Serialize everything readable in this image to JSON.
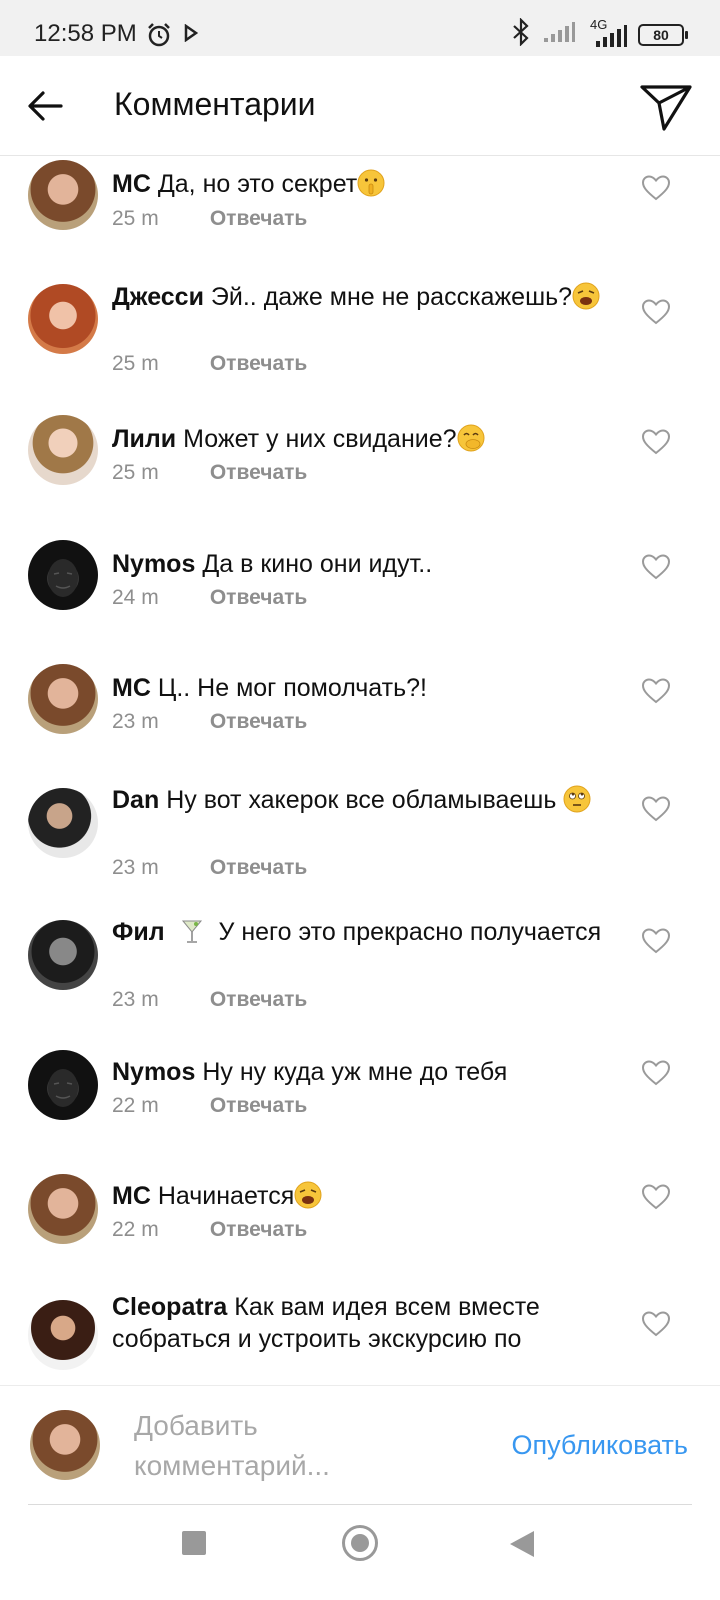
{
  "status_bar": {
    "time": "12:58 PM",
    "network": "4G",
    "battery": "80"
  },
  "header": {
    "title": "Комментарии",
    "back_icon": "arrow-left-icon",
    "send_icon": "paper-plane-icon"
  },
  "comments": [
    {
      "user": "MC",
      "text": "Да, но это секрет",
      "emoji": "shushing-face",
      "time": "25 m",
      "reply": "Отвечать"
    },
    {
      "user": "Джесси",
      "text": "Эй.. даже мне не расскажешь?",
      "emoji": "weary-face",
      "time": "25 m",
      "reply": "Отвечать"
    },
    {
      "user": "Лили",
      "text": "Может у них свидание?",
      "emoji": "hand-over-mouth-face",
      "time": "25 m",
      "reply": "Отвечать"
    },
    {
      "user": "Nymos",
      "text": "Да в кино они идут..",
      "time": "24 m",
      "reply": "Отвечать"
    },
    {
      "user": "MC",
      "text": "Ц.. Не мог помолчать?!",
      "time": "23 m",
      "reply": "Отвечать"
    },
    {
      "user": "Dan",
      "text": "Ну вот хакерок все обламываешь",
      "emoji": "eye-roll-face",
      "time": "23 m",
      "reply": "Отвечать"
    },
    {
      "user": "Фил",
      "user_emoji": "cocktail-glass",
      "text": "У него это прекрасно получается",
      "time": "23 m",
      "reply": "Отвечать"
    },
    {
      "user": "Nymos",
      "text": "Ну ну куда уж мне до тебя",
      "time": "22 m",
      "reply": "Отвечать"
    },
    {
      "user": "MC",
      "text": "Начинается",
      "emoji": "weary-face",
      "time": "22 m",
      "reply": "Отвечать"
    },
    {
      "user": "Cleopatra",
      "text": "Как вам идея всем вместе собраться и устроить экскурсию по"
    }
  ],
  "composer": {
    "placeholder": "Добавить комментарий...",
    "publish_label": "Опубликовать"
  },
  "colors": {
    "accent": "#3897f0",
    "muted_text": "#8e8e8e",
    "status_bar_bg": "#f1f1f1"
  }
}
